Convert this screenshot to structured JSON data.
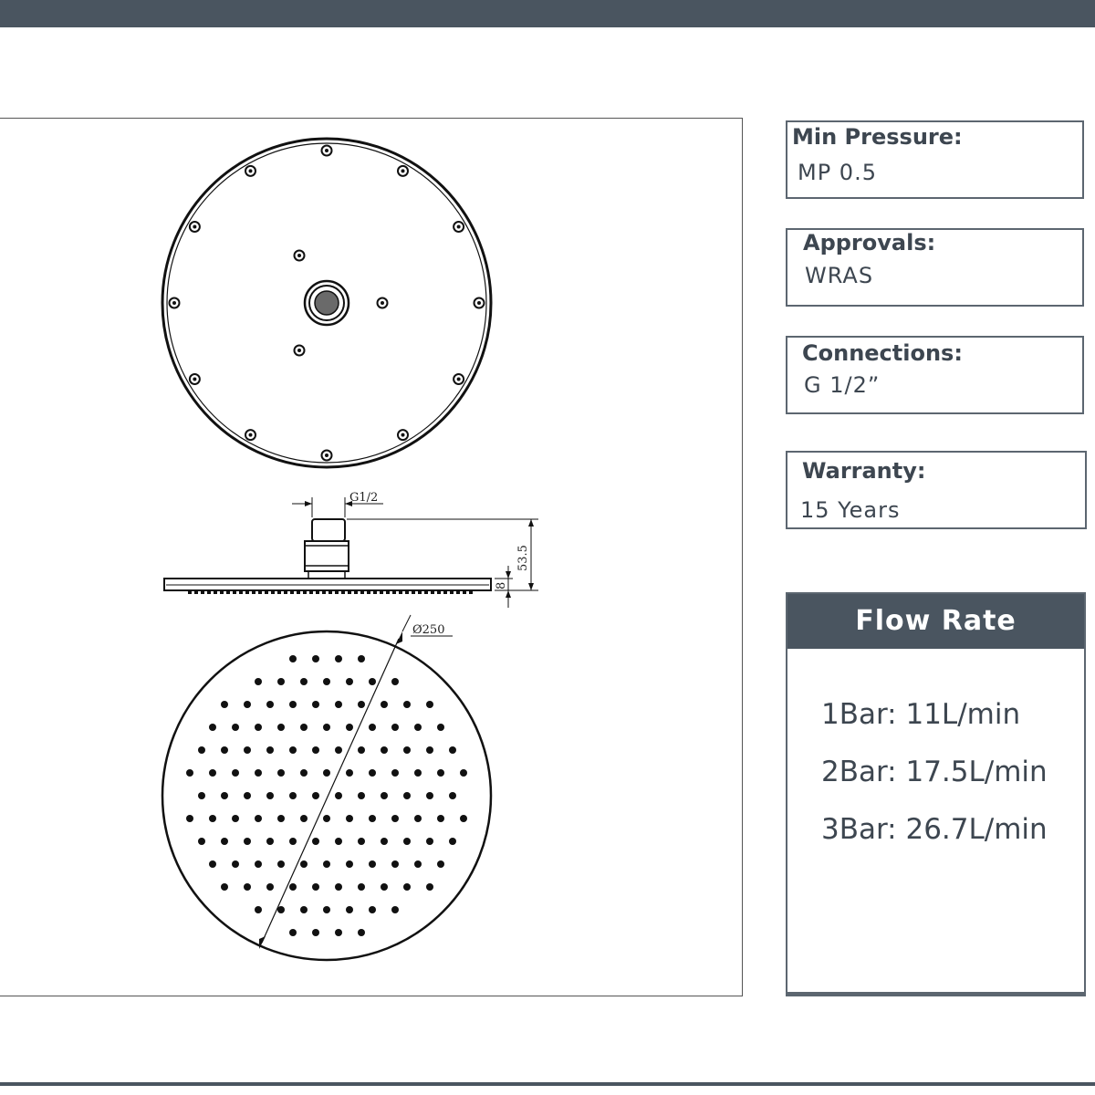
{
  "specs": [
    {
      "label": "Min Pressure:",
      "value": "MP 0.5"
    },
    {
      "label": "Approvals:",
      "value": "WRAS"
    },
    {
      "label": "Connections:",
      "value": "G 1/2”"
    },
    {
      "label": "Warranty:",
      "value": "15 Years"
    }
  ],
  "flow_rate": {
    "title": "Flow Rate",
    "rows": [
      {
        "text": "1Bar:  11L/min"
      },
      {
        "text": "2Bar:  17.5L/min"
      },
      {
        "text": "3Bar:  26.7L/min"
      }
    ]
  },
  "drawing": {
    "connection_label": "G1/2",
    "height_dim": "53.5",
    "plate_dim": "8",
    "diameter_label": "Ø250"
  }
}
